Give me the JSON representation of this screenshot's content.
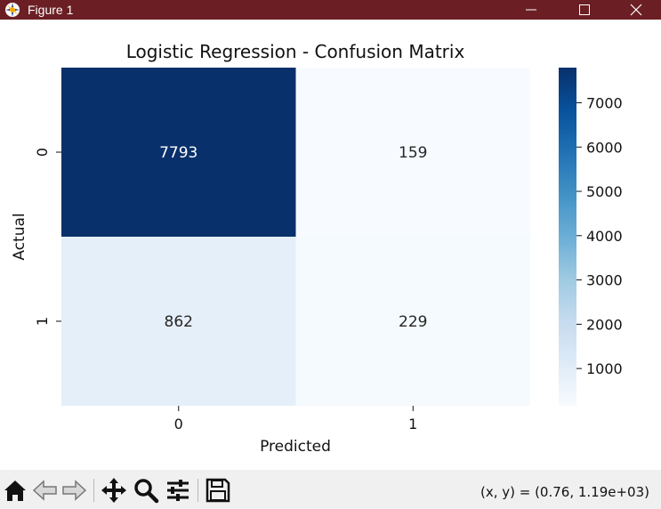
{
  "window": {
    "title": "Figure 1",
    "titlebar_color": "#6b1f24",
    "controls": [
      "minimize-icon",
      "maximize-icon",
      "close-icon"
    ]
  },
  "chart_data": {
    "type": "heatmap",
    "title": "Logistic Regression - Confusion Matrix",
    "xlabel": "Predicted",
    "ylabel": "Actual",
    "x_categories": [
      "0",
      "1"
    ],
    "y_categories": [
      "0",
      "1"
    ],
    "values": [
      [
        7793,
        159
      ],
      [
        862,
        229
      ]
    ],
    "annotations": [
      "7793",
      "159",
      "862",
      "229"
    ],
    "colormap": "Blues",
    "colorbar": {
      "range": [
        159,
        7793
      ],
      "ticks": [
        1000,
        2000,
        3000,
        4000,
        5000,
        6000,
        7000
      ],
      "tick_labels": [
        "1000",
        "2000",
        "3000",
        "4000",
        "5000",
        "6000",
        "7000"
      ]
    },
    "grid": false
  },
  "toolbar": {
    "buttons": [
      "home-icon",
      "back-icon",
      "forward-icon",
      "pan-icon",
      "zoom-icon",
      "configure-icon",
      "save-icon"
    ],
    "coordinates": "(x, y) = (0.76, 1.19e+03)"
  }
}
